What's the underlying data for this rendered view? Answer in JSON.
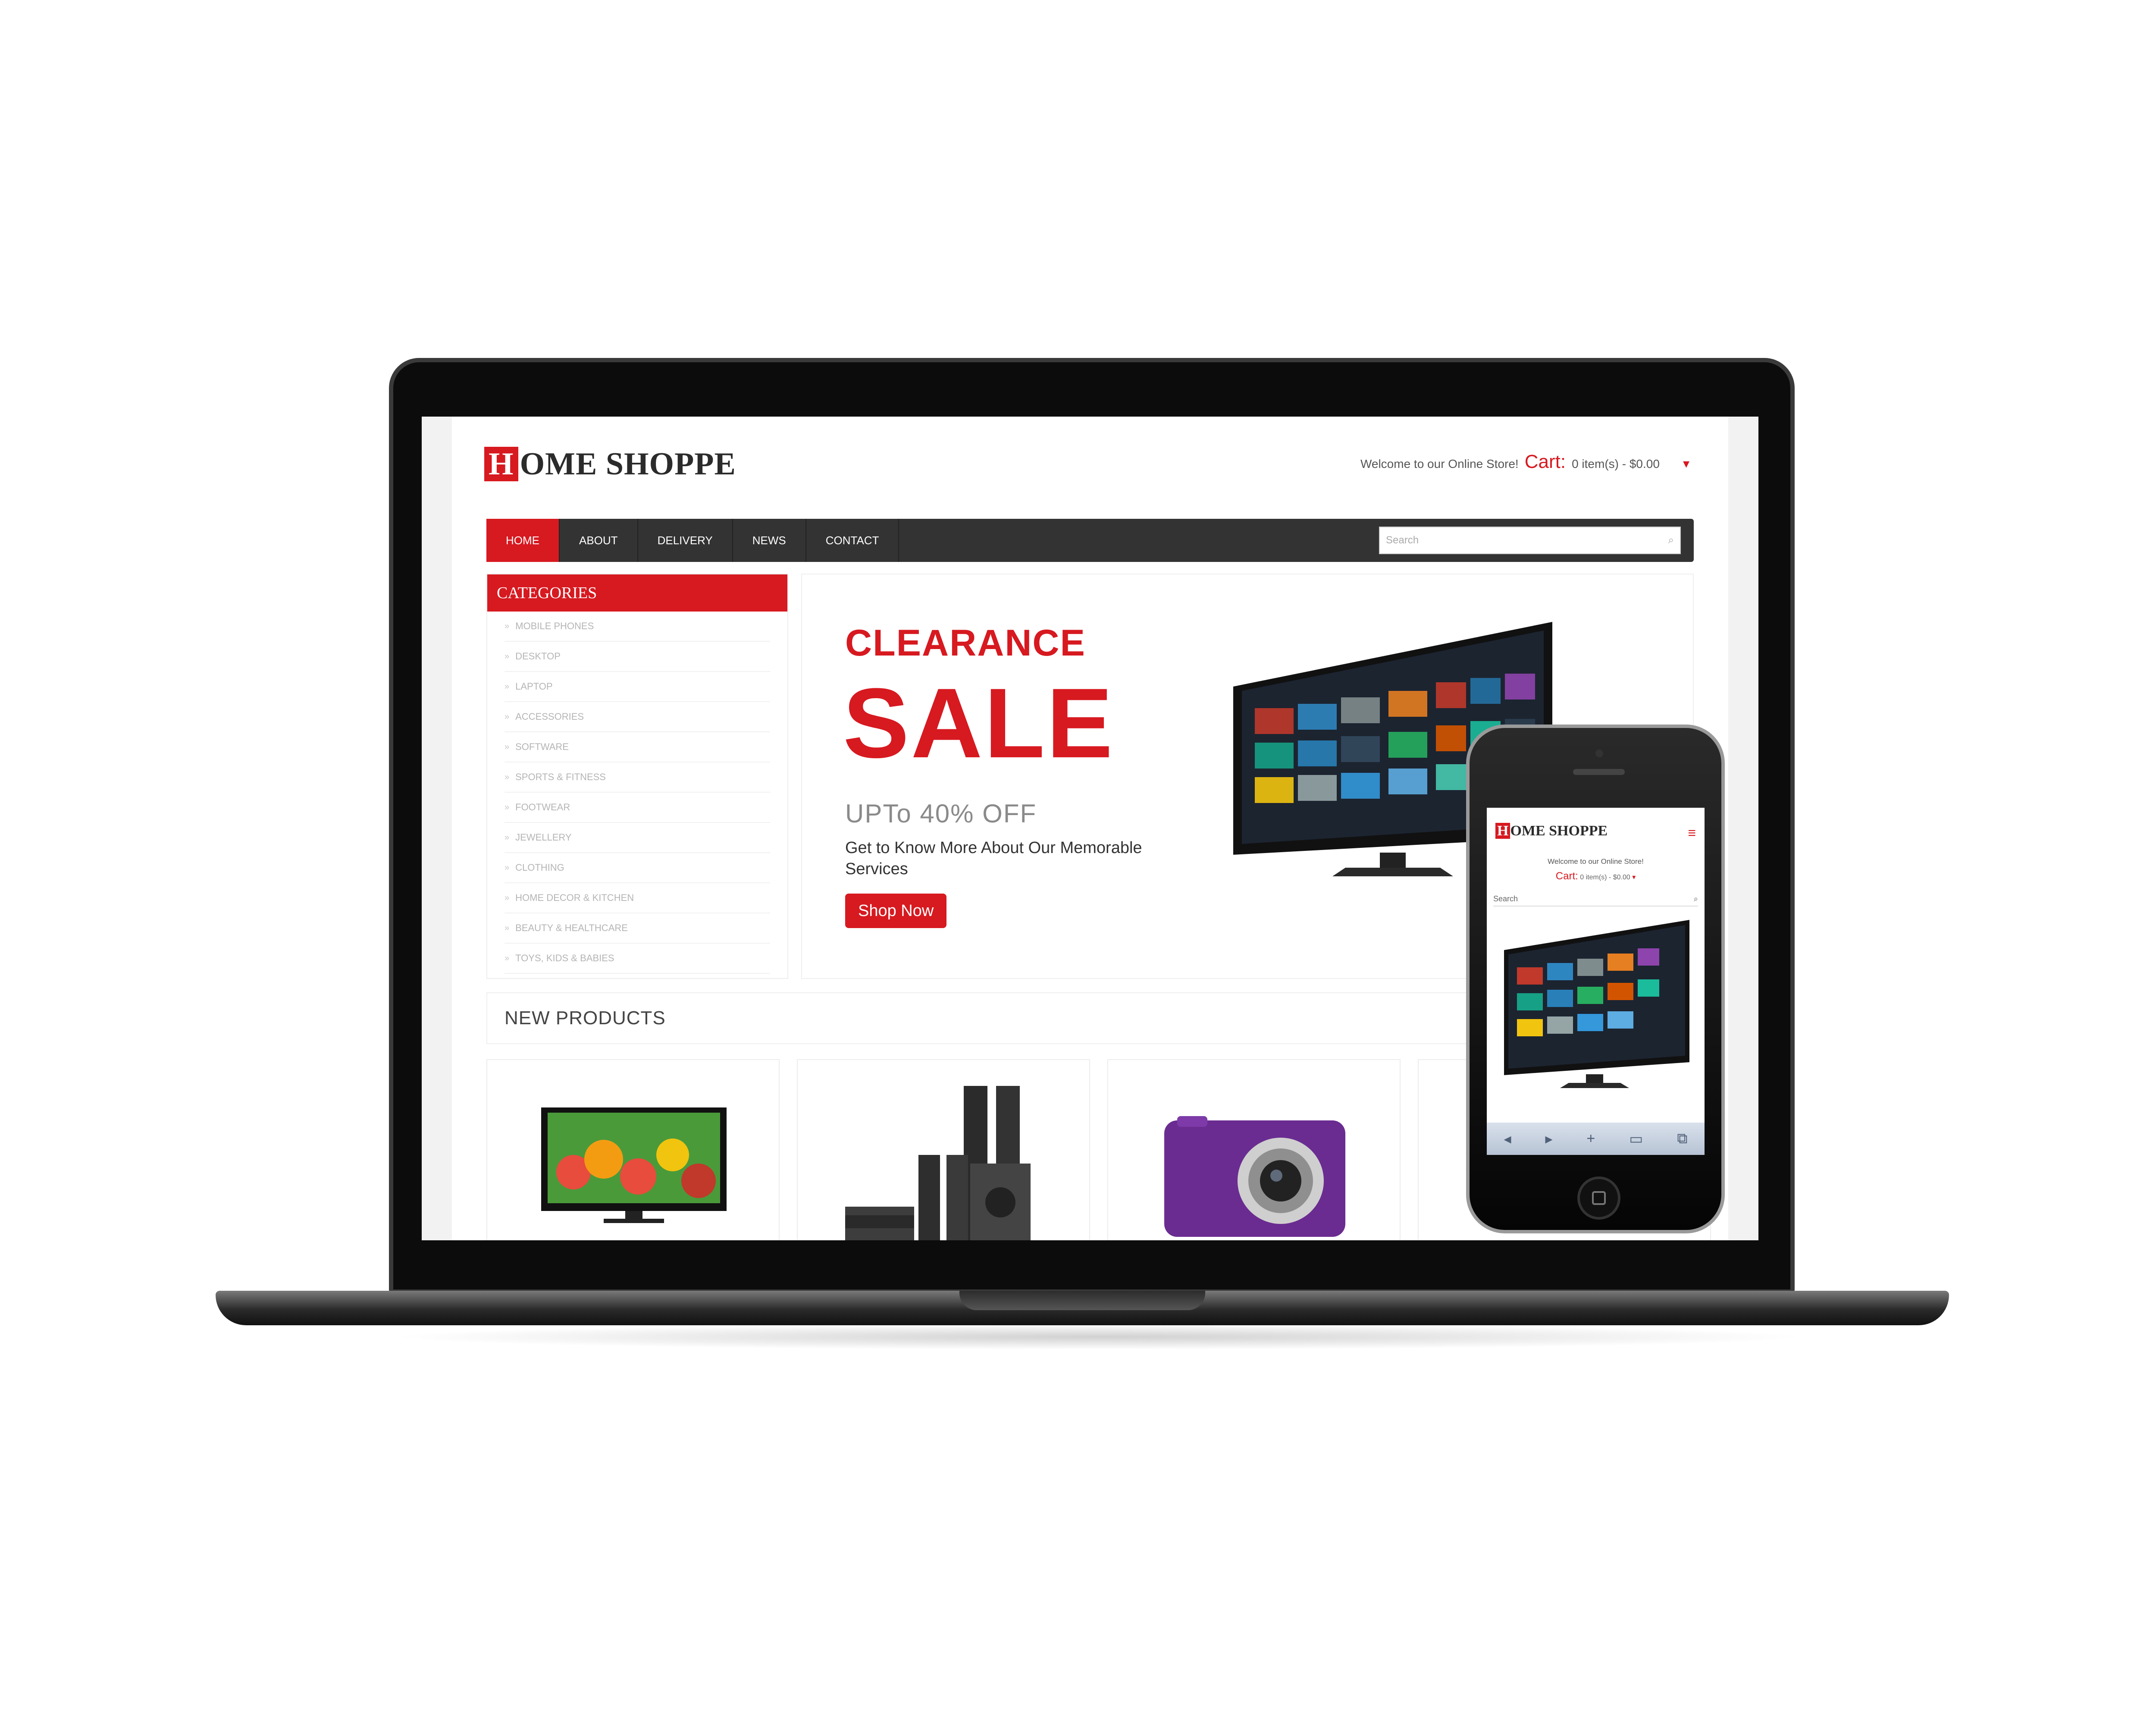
{
  "site": {
    "logo_initial": "H",
    "logo_rest": "OME SHOPPE",
    "welcome": "Welcome to our Online Store!",
    "cart_label": "Cart:",
    "cart_summary": "0 item(s) - $0.00",
    "cart_dropdown_icon": "▾"
  },
  "nav": {
    "items": [
      "HOME",
      "ABOUT",
      "DELIVERY",
      "NEWS",
      "CONTACT"
    ],
    "search_placeholder": "Search",
    "search_icon": "⌕"
  },
  "categories": {
    "title": "CATEGORIES",
    "bullet": "»",
    "items": [
      "MOBILE PHONES",
      "DESKTOP",
      "LAPTOP",
      "ACCESSORIES",
      "SOFTWARE",
      "SPORTS & FITNESS",
      "FOOTWEAR",
      "JEWELLERY",
      "CLOTHING",
      "HOME DECOR & KITCHEN",
      "BEAUTY & HEALTHCARE",
      "TOYS, KIDS & BABIES"
    ]
  },
  "banner": {
    "line1": "CLEARANCE",
    "line2": "SALE",
    "line3": "UPTo 40% OFF",
    "subtitle": "Get to Know More About Our Memorable Services",
    "button": "Shop Now"
  },
  "new_products": {
    "title": "NEW PRODUCTS"
  },
  "phone": {
    "menu_icon": "≡",
    "search_label": "Search",
    "search_icon": "⌕",
    "toolbar_icons": [
      "◂",
      "▸",
      "+",
      "▭",
      "⧉"
    ]
  },
  "colors": {
    "brand_red": "#d71920",
    "nav_dark": "#333333"
  }
}
